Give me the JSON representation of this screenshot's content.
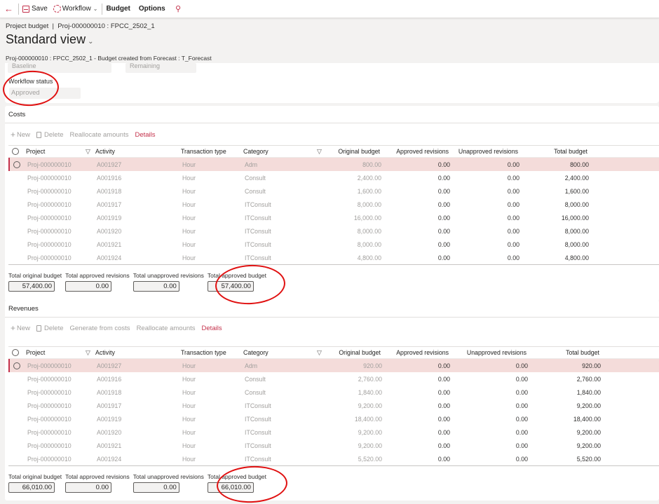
{
  "toolbar": {
    "back_icon": "back-arrow-icon",
    "save_label": "Save",
    "workflow_label": "Workflow",
    "budget_label": "Budget",
    "options_label": "Options",
    "search_icon": "search-icon"
  },
  "header": {
    "breadcrumb": "Project budget  |  Proj-000000010 : FPCC_2502_1",
    "title": "Standard view",
    "subtitle": "Proj-000000010 : FPCC_2502_1 - Budget created from Forecast : T_Forecast"
  },
  "fields": {
    "baseline_label": "Baseline",
    "remaining_label": "Remaining",
    "workflow_status_label": "Workflow status",
    "workflow_status_value": "Approved"
  },
  "costs": {
    "title": "Costs",
    "actions": {
      "new": "New",
      "delete": "Delete",
      "reallocate": "Reallocate amounts",
      "details": "Details"
    },
    "columns": [
      "Project",
      "Activity",
      "Transaction type",
      "Category",
      "Original budget",
      "Approved revisions",
      "Unapproved revisions",
      "Total budget"
    ],
    "rows": [
      {
        "project": "Proj-000000010",
        "activity": "A001927",
        "type": "Hour",
        "category": "Adm",
        "original": "800.00",
        "approved": "0.00",
        "unapproved": "0.00",
        "total": "800.00"
      },
      {
        "project": "Proj-000000010",
        "activity": "A001916",
        "type": "Hour",
        "category": "Consult",
        "original": "2,400.00",
        "approved": "0.00",
        "unapproved": "0.00",
        "total": "2,400.00"
      },
      {
        "project": "Proj-000000010",
        "activity": "A001918",
        "type": "Hour",
        "category": "Consult",
        "original": "1,600.00",
        "approved": "0.00",
        "unapproved": "0.00",
        "total": "1,600.00"
      },
      {
        "project": "Proj-000000010",
        "activity": "A001917",
        "type": "Hour",
        "category": "ITConsult",
        "original": "8,000.00",
        "approved": "0.00",
        "unapproved": "0.00",
        "total": "8,000.00"
      },
      {
        "project": "Proj-000000010",
        "activity": "A001919",
        "type": "Hour",
        "category": "ITConsult",
        "original": "16,000.00",
        "approved": "0.00",
        "unapproved": "0.00",
        "total": "16,000.00"
      },
      {
        "project": "Proj-000000010",
        "activity": "A001920",
        "type": "Hour",
        "category": "ITConsult",
        "original": "8,000.00",
        "approved": "0.00",
        "unapproved": "0.00",
        "total": "8,000.00"
      },
      {
        "project": "Proj-000000010",
        "activity": "A001921",
        "type": "Hour",
        "category": "ITConsult",
        "original": "8,000.00",
        "approved": "0.00",
        "unapproved": "0.00",
        "total": "8,000.00"
      },
      {
        "project": "Proj-000000010",
        "activity": "A001924",
        "type": "Hour",
        "category": "ITConsult",
        "original": "4,800.00",
        "approved": "0.00",
        "unapproved": "0.00",
        "total": "4,800.00"
      }
    ],
    "totals": [
      {
        "label": "Total original budget",
        "value": "57,400.00"
      },
      {
        "label": "Total approved revisions",
        "value": "0.00"
      },
      {
        "label": "Total unapproved revisions",
        "value": "0.00"
      },
      {
        "label": "Total approved budget",
        "value": "57,400.00"
      }
    ]
  },
  "revenues": {
    "title": "Revenues",
    "actions": {
      "new": "New",
      "delete": "Delete",
      "generate": "Generate from costs",
      "reallocate": "Reallocate amounts",
      "details": "Details"
    },
    "columns": [
      "Project",
      "Activity",
      "Transaction type",
      "Category",
      "Original budget",
      "Approved revisions",
      "Unapproved revisions",
      "Total budget"
    ],
    "rows": [
      {
        "project": "Proj-000000010",
        "activity": "A001927",
        "type": "Hour",
        "category": "Adm",
        "original": "920.00",
        "approved": "0.00",
        "unapproved": "0.00",
        "total": "920.00"
      },
      {
        "project": "Proj-000000010",
        "activity": "A001916",
        "type": "Hour",
        "category": "Consult",
        "original": "2,760.00",
        "approved": "0.00",
        "unapproved": "0.00",
        "total": "2,760.00"
      },
      {
        "project": "Proj-000000010",
        "activity": "A001918",
        "type": "Hour",
        "category": "Consult",
        "original": "1,840.00",
        "approved": "0.00",
        "unapproved": "0.00",
        "total": "1,840.00"
      },
      {
        "project": "Proj-000000010",
        "activity": "A001917",
        "type": "Hour",
        "category": "ITConsult",
        "original": "9,200.00",
        "approved": "0.00",
        "unapproved": "0.00",
        "total": "9,200.00"
      },
      {
        "project": "Proj-000000010",
        "activity": "A001919",
        "type": "Hour",
        "category": "ITConsult",
        "original": "18,400.00",
        "approved": "0.00",
        "unapproved": "0.00",
        "total": "18,400.00"
      },
      {
        "project": "Proj-000000010",
        "activity": "A001920",
        "type": "Hour",
        "category": "ITConsult",
        "original": "9,200.00",
        "approved": "0.00",
        "unapproved": "0.00",
        "total": "9,200.00"
      },
      {
        "project": "Proj-000000010",
        "activity": "A001921",
        "type": "Hour",
        "category": "ITConsult",
        "original": "9,200.00",
        "approved": "0.00",
        "unapproved": "0.00",
        "total": "9,200.00"
      },
      {
        "project": "Proj-000000010",
        "activity": "A001924",
        "type": "Hour",
        "category": "ITConsult",
        "original": "5,520.00",
        "approved": "0.00",
        "unapproved": "0.00",
        "total": "5,520.00"
      }
    ],
    "totals": [
      {
        "label": "Total original budget",
        "value": "66,010.00"
      },
      {
        "label": "Total approved revisions",
        "value": "0.00"
      },
      {
        "label": "Total unapproved revisions",
        "value": "0.00"
      },
      {
        "label": "Total approved budget",
        "value": "66,010.00"
      }
    ]
  },
  "selected_row_index": 0,
  "colors": {
    "accent": "#c4314b",
    "selected_row": "#f4dcda",
    "annotation": "#e01010"
  }
}
